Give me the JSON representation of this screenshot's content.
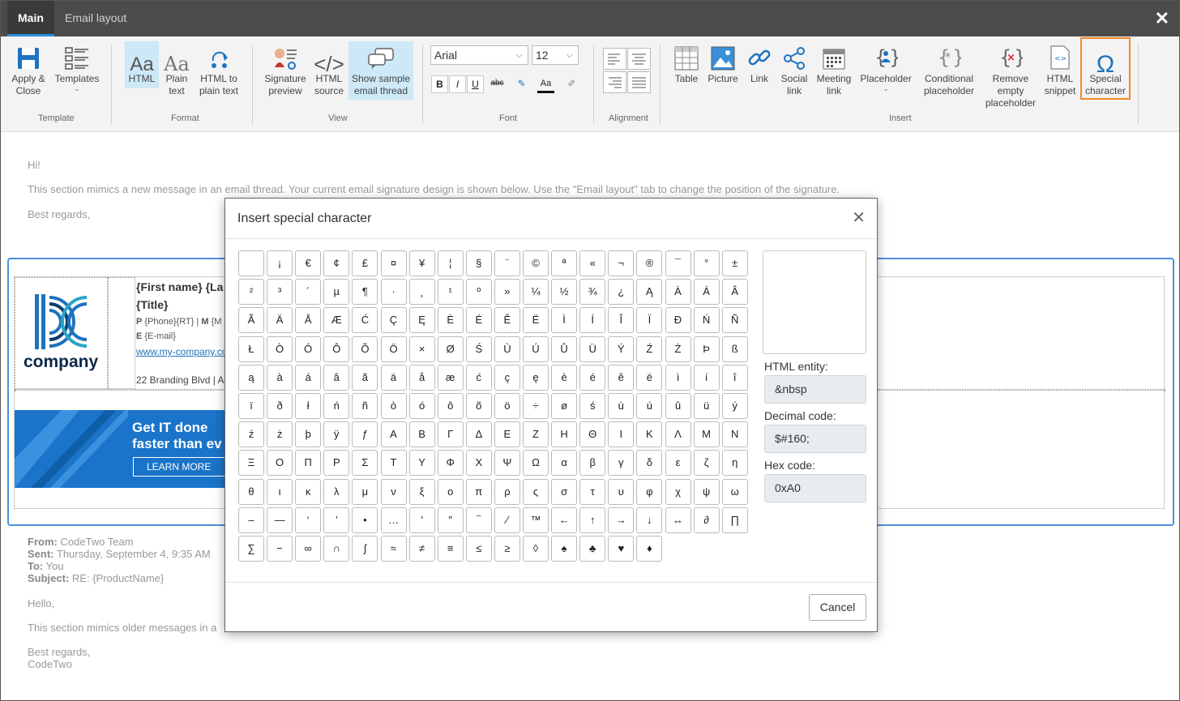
{
  "tabs": [
    {
      "label": "Main",
      "active": true
    },
    {
      "label": "Email layout",
      "active": false
    }
  ],
  "ribbon": {
    "template": {
      "group": "Template",
      "apply_close": "Apply &\nClose",
      "templates": "Templates"
    },
    "format": {
      "group": "Format",
      "html": "HTML",
      "plain_text": "Plain\ntext",
      "html_to_plain": "HTML to\nplain text"
    },
    "view": {
      "group": "View",
      "signature_preview": "Signature\npreview",
      "html_source": "HTML\nsource",
      "show_sample": "Show sample\nemail thread"
    },
    "font": {
      "group": "Font",
      "family": "Arial",
      "size": "12",
      "bold": "B",
      "italic": "I",
      "underline": "U",
      "strike": "abc",
      "font_color": "Aa"
    },
    "alignment": {
      "group": "Alignment"
    },
    "insert": {
      "group": "Insert",
      "table": "Table",
      "picture": "Picture",
      "link": "Link",
      "social_link": "Social\nlink",
      "meeting_link": "Meeting\nlink",
      "placeholder": "Placeholder",
      "conditional": "Conditional\nplaceholder",
      "remove_empty": "Remove\nempty\nplaceholder",
      "html_snippet": "HTML\nsnippet",
      "special_character": "Special\ncharacter"
    }
  },
  "email": {
    "greeting": "Hi!",
    "body": "This section mimics a new message in an email thread. Your current email signature design is shown below. Use the \"Email layout\" tab to change the position of the signature.",
    "regards": "Best regards,",
    "signature": {
      "logo_text": "company",
      "name_line": "{First name} {La",
      "title_line": "{Title}",
      "phone_line_p": "P",
      "phone_line_rest": "{Phone}{RT} |",
      "phone_line_m": "M",
      "phone_line_m_rest": "{M",
      "email_e": "E",
      "email_rest": "{E-mail}",
      "website": "www.my-company.co",
      "address": "22 Branding Blvd | Az",
      "banner_line1": "Get IT done",
      "banner_line2": "faster than ev",
      "banner_button": "LEARN MORE"
    },
    "older": {
      "from_label": "From:",
      "from": "CodeTwo Team",
      "sent_label": "Sent:",
      "sent": "Thursday, September 4, 9:35 AM",
      "to_label": "To:",
      "to": "You",
      "subject_label": "Subject:",
      "subject": "RE: {ProductName}",
      "hello": "Hello,",
      "body": "This section mimics older messages in a",
      "regards": "Best regards,",
      "signoff": "CodeTwo"
    }
  },
  "modal": {
    "title": "Insert special character",
    "characters": [
      " ",
      "¡",
      "€",
      "¢",
      "£",
      "¤",
      "¥",
      "¦",
      "§",
      "¨",
      "©",
      "ª",
      "«",
      "¬",
      "®",
      "¯",
      "°",
      "±",
      "²",
      "³",
      "´",
      "µ",
      "¶",
      "·",
      "¸",
      "¹",
      "º",
      "»",
      "¼",
      "½",
      "¾",
      "¿",
      "Ą",
      "À",
      "Á",
      "Â",
      "Ã",
      "Ä",
      "Å",
      "Æ",
      "Ć",
      "Ç",
      "Ę",
      "È",
      "É",
      "Ê",
      "Ë",
      "Ì",
      "Í",
      "Î",
      "Ï",
      "Ð",
      "Ń",
      "Ñ",
      "Ł",
      "Ò",
      "Ó",
      "Ô",
      "Õ",
      "Ö",
      "×",
      "Ø",
      "Ś",
      "Ù",
      "Ú",
      "Û",
      "Ü",
      "Ý",
      "Ź",
      "Ż",
      "Þ",
      "ß",
      "ą",
      "à",
      "á",
      "â",
      "ã",
      "ä",
      "å",
      "æ",
      "ć",
      "ç",
      "ę",
      "è",
      "é",
      "ê",
      "ë",
      "ì",
      "í",
      "î",
      "ï",
      "ð",
      "ł",
      "ń",
      "ñ",
      "ò",
      "ó",
      "ô",
      "õ",
      "ö",
      "÷",
      "ø",
      "ś",
      "ù",
      "ú",
      "û",
      "ü",
      "ý",
      "ź",
      "ż",
      "þ",
      "ÿ",
      "ƒ",
      "Α",
      "Β",
      "Γ",
      "Δ",
      "Ε",
      "Ζ",
      "Η",
      "Θ",
      "Ι",
      "Κ",
      "Λ",
      "Μ",
      "Ν",
      "Ξ",
      "Ο",
      "Π",
      "Ρ",
      "Σ",
      "Τ",
      "Υ",
      "Φ",
      "Χ",
      "Ψ",
      "Ω",
      "α",
      "β",
      "γ",
      "δ",
      "ε",
      "ζ",
      "η",
      "θ",
      "ι",
      "κ",
      "λ",
      "μ",
      "ν",
      "ξ",
      "ο",
      "π",
      "ρ",
      "ς",
      "σ",
      "τ",
      "υ",
      "φ",
      "χ",
      "ψ",
      "ω",
      "–",
      "—",
      "‘",
      "’",
      "•",
      "…",
      "′",
      "″",
      "‾",
      "⁄",
      "™",
      "←",
      "↑",
      "→",
      "↓",
      "↔",
      "∂",
      "∏",
      "∑",
      "−",
      "∞",
      "∩",
      "∫",
      "≈",
      "≠",
      "≡",
      "≤",
      "≥",
      "◊",
      "♠",
      "♣",
      "♥",
      "♦"
    ],
    "html_entity_label": "HTML entity:",
    "html_entity": "&nbsp",
    "decimal_label": "Decimal code:",
    "decimal": "$#160;",
    "hex_label": "Hex code:",
    "hex": "0xA0",
    "cancel": "Cancel"
  }
}
